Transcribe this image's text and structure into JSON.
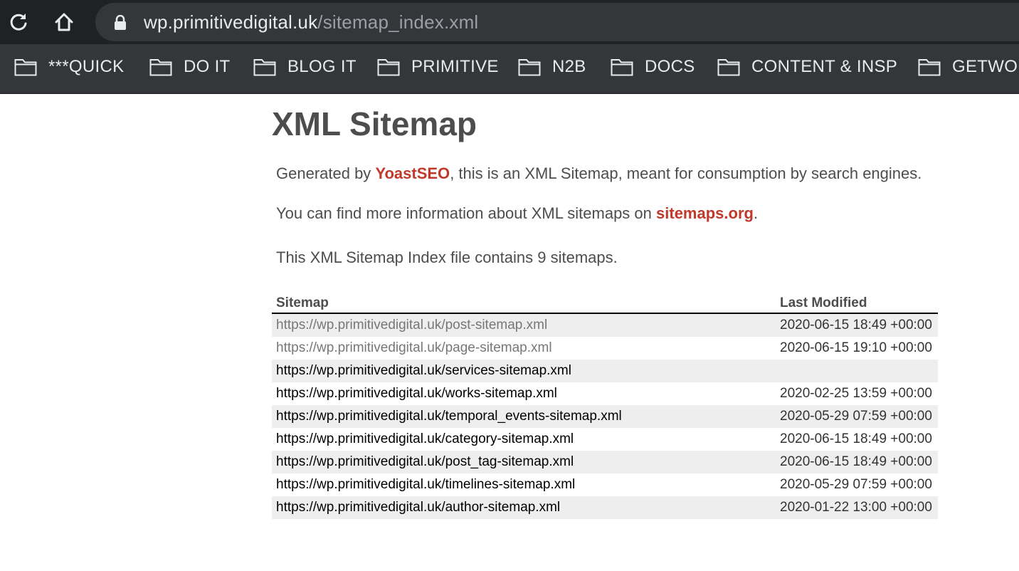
{
  "browser": {
    "url_host": "wp.primitivedigital.uk",
    "url_path": "/sitemap_index.xml",
    "bookmarks": [
      "***QUICK",
      "DO IT",
      "BLOG IT",
      "PRIMITIVE",
      "N2B",
      "DOCS",
      "CONTENT & INSP",
      "GETWORK"
    ],
    "icons": [
      "reload-icon",
      "home-icon",
      "lock-icon",
      "folder-icon"
    ]
  },
  "page": {
    "title": "XML Sitemap",
    "intro_prefix": "Generated by ",
    "intro_link": "YoastSEO",
    "intro_suffix": ", this is an XML Sitemap, meant for consumption by search engines.",
    "info_prefix": "You can find more information about XML sitemaps on ",
    "info_link": "sitemaps.org",
    "info_suffix": ".",
    "count_text": "This XML Sitemap Index file contains 9 sitemaps."
  },
  "table": {
    "headers": [
      "Sitemap",
      "Last Modified"
    ],
    "rows": [
      {
        "url": "https://wp.primitivedigital.uk/post-sitemap.xml",
        "modified": "2020-06-15 18:49 +00:00"
      },
      {
        "url": "https://wp.primitivedigital.uk/page-sitemap.xml",
        "modified": "2020-06-15 19:10 +00:00"
      },
      {
        "url": "https://wp.primitivedigital.uk/services-sitemap.xml",
        "modified": ""
      },
      {
        "url": "https://wp.primitivedigital.uk/works-sitemap.xml",
        "modified": "2020-02-25 13:59 +00:00"
      },
      {
        "url": "https://wp.primitivedigital.uk/temporal_events-sitemap.xml",
        "modified": "2020-05-29 07:59 +00:00"
      },
      {
        "url": "https://wp.primitivedigital.uk/category-sitemap.xml",
        "modified": "2020-06-15 18:49 +00:00"
      },
      {
        "url": "https://wp.primitivedigital.uk/post_tag-sitemap.xml",
        "modified": "2020-06-15 18:49 +00:00"
      },
      {
        "url": "https://wp.primitivedigital.uk/timelines-sitemap.xml",
        "modified": "2020-05-29 07:59 +00:00"
      },
      {
        "url": "https://wp.primitivedigital.uk/author-sitemap.xml",
        "modified": "2020-01-22 13:00 +00:00"
      }
    ]
  },
  "colors": {
    "link_accent": "#c0392b",
    "text": "#4d4d4d",
    "row_stripe": "#eeeeee",
    "chrome_dark": "#202124",
    "chrome_bar": "#35363a"
  }
}
